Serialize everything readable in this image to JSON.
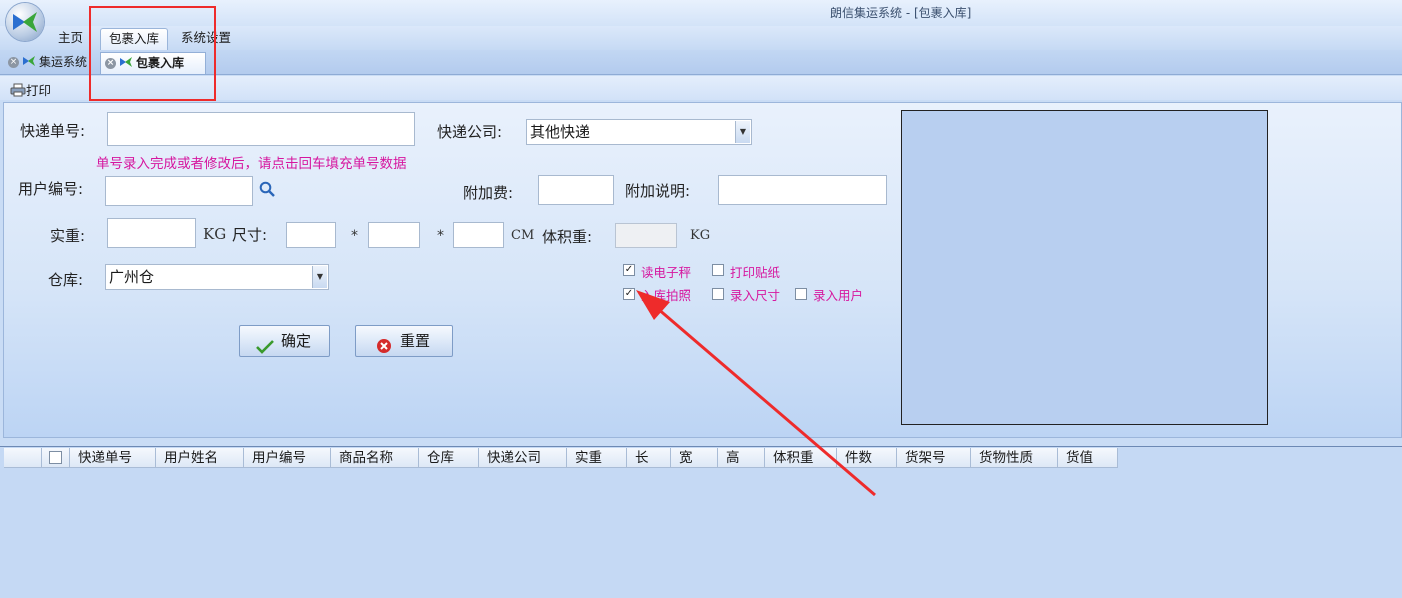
{
  "window": {
    "title": "朗信集运系统 - [包裹入库]"
  },
  "ribbon": {
    "tabs": [
      "主页",
      "包裹入库",
      "系统设置"
    ]
  },
  "doc_tabs": [
    "集运系统",
    "包裹入库"
  ],
  "toolbar": {
    "print_label": "打印"
  },
  "form": {
    "tracking_label": "快递单号:",
    "tracking_value": "",
    "hint": "单号录入完成或者修改后，请点击回车填充单号数据",
    "courier_label": "快递公司:",
    "courier_value": "其他快递",
    "user_id_label": "用户编号:",
    "extra_fee_label": "附加费:",
    "extra_note_label": "附加说明:",
    "weight_label": "实重:",
    "weight_unit": "KG",
    "size_label": "尺寸:",
    "times1": "*",
    "times2": "*",
    "size_unit": "CM",
    "vol_weight_label": "体积重:",
    "vol_weight_unit": "KG",
    "warehouse_label": "仓库:",
    "warehouse_value": "广州仓",
    "confirm_label": "确定",
    "reset_label": "重置"
  },
  "options": {
    "read_scale": {
      "label": "读电子秤",
      "checked": true
    },
    "print_sticker": {
      "label": "打印贴纸",
      "checked": false
    },
    "photo": {
      "label": "入库拍照",
      "checked": true
    },
    "enter_size": {
      "label": "录入尺寸",
      "checked": false
    },
    "enter_user": {
      "label": "录入用户",
      "checked": false
    }
  },
  "grid": {
    "columns": [
      "快递单号",
      "用户姓名",
      "用户编号",
      "商品名称",
      "仓库",
      "快递公司",
      "实重",
      "长",
      "宽",
      "高",
      "体积重",
      "件数",
      "货架号",
      "货物性质",
      "货值"
    ]
  },
  "colors": {
    "accent_magenta": "#d6169f",
    "annotation_red": "#ee2b2b"
  }
}
